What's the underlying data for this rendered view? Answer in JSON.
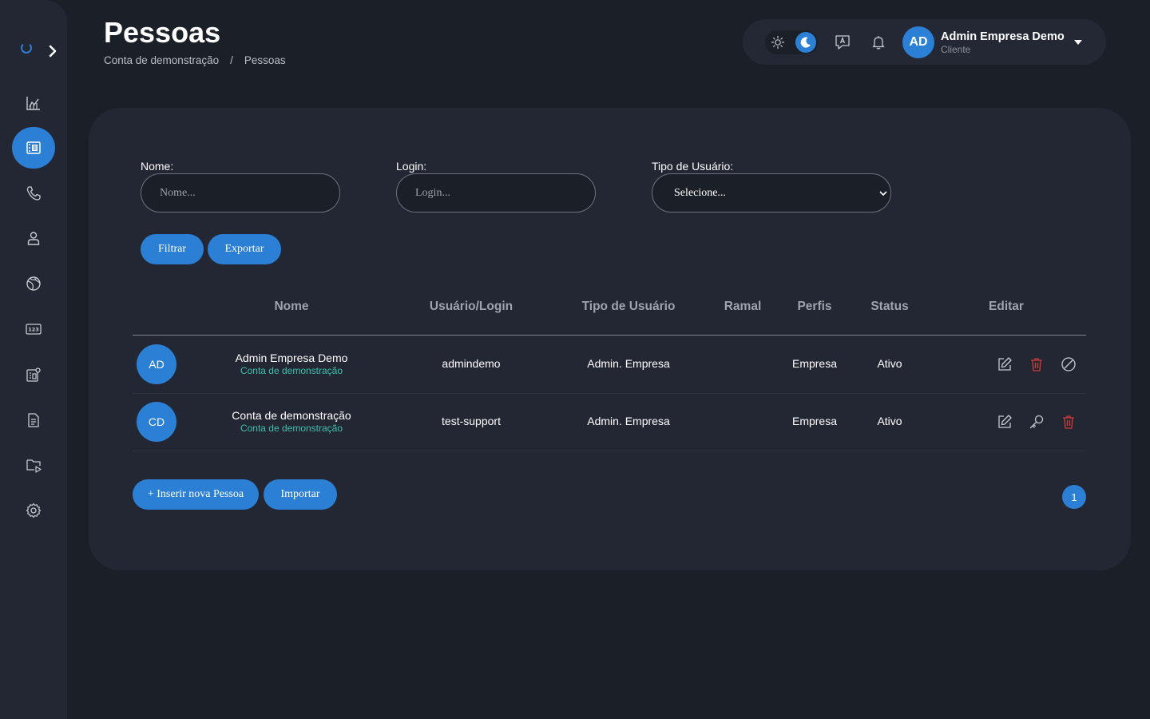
{
  "page": {
    "title": "Pessoas",
    "breadcrumb": [
      "Conta de demonstração",
      "/",
      "Pessoas"
    ]
  },
  "sidebar": {
    "items": [
      {
        "icon": "chart-icon"
      },
      {
        "icon": "contacts-book-icon",
        "active": true
      },
      {
        "icon": "phone-icon"
      },
      {
        "icon": "user-icon"
      },
      {
        "icon": "globe-icon"
      },
      {
        "icon": "numbers-icon"
      },
      {
        "icon": "contact-settings-icon"
      },
      {
        "icon": "document-icon"
      },
      {
        "icon": "video-folder-icon"
      },
      {
        "icon": "settings-gear-icon"
      }
    ]
  },
  "topbar": {
    "avatar_initials": "AD",
    "user_name": "Admin Empresa Demo",
    "user_role": "Cliente"
  },
  "filters": {
    "name_label": "Nome:",
    "name_placeholder": "Nome...",
    "login_label": "Login:",
    "login_placeholder": "Login...",
    "type_label": "Tipo de Usuário:",
    "type_selected": "Selecione...",
    "filter_button": "Filtrar",
    "export_button": "Exportar"
  },
  "table": {
    "columns": [
      "Nome",
      "Usuário/Login",
      "Tipo de Usuário",
      "Ramal",
      "Perfis",
      "Status",
      "Editar"
    ],
    "rows": [
      {
        "initials": "AD",
        "name": "Admin Empresa Demo",
        "account": "Conta de demonstração",
        "login": "admindemo",
        "type": "Admin. Empresa",
        "ramal": "",
        "profile": "Empresa",
        "status": "Ativo",
        "actions": [
          "edit-icon",
          "trash-icon",
          "block-icon"
        ]
      },
      {
        "initials": "CD",
        "name": "Conta de demonstração",
        "account": "Conta de demonstração",
        "login": "test-support",
        "type": "Admin. Empresa",
        "ramal": "",
        "profile": "Empresa",
        "status": "Ativo",
        "actions": [
          "edit-icon",
          "key-icon",
          "trash-icon"
        ]
      }
    ]
  },
  "footer": {
    "insert_button": "+ Inserir nova Pessoa",
    "import_button": "Importar",
    "current_page": "1"
  },
  "colors": {
    "accent": "#2b7fd4",
    "danger": "#d43a3a",
    "subtext": "#3fbfad",
    "background": "#1b1f27",
    "panel": "#222733"
  }
}
